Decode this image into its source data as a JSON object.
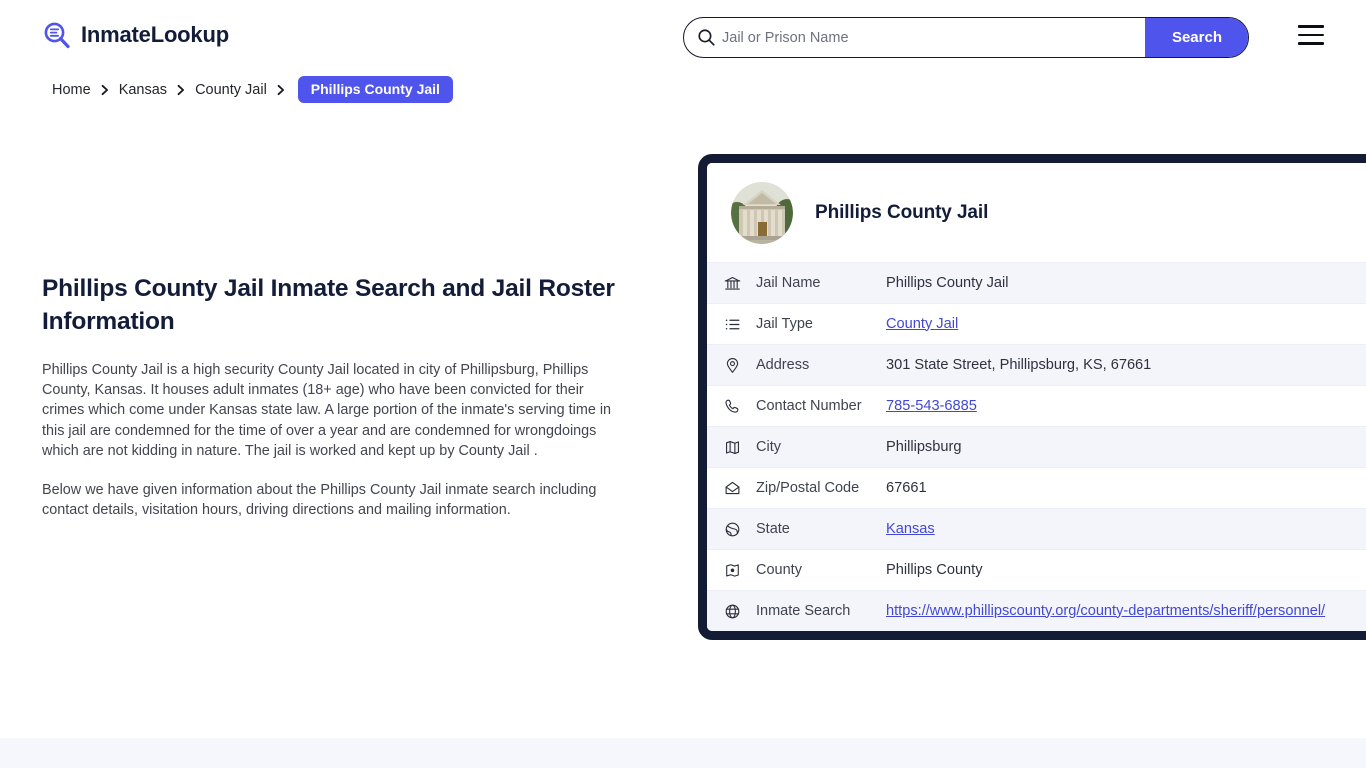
{
  "header": {
    "logo_text": "InmateLookup",
    "logo_icon": "magnifier-list-icon",
    "menu_icon": "hamburger-menu-icon",
    "search": {
      "icon": "search-icon",
      "placeholder": "Jail or Prison Name",
      "value": "",
      "button_label": "Search"
    }
  },
  "breadcrumb": {
    "items": [
      {
        "label": "Home",
        "current": false
      },
      {
        "label": "Kansas",
        "current": false
      },
      {
        "label": "County Jail",
        "current": false
      },
      {
        "label": "Phillips County Jail",
        "current": true
      }
    ],
    "separator": "❯"
  },
  "main": {
    "title": "Phillips County Jail Inmate Search and Jail Roster Information",
    "paragraphs": [
      "Phillips County Jail is a high security County Jail located in city of Phillipsburg, Phillips County, Kansas. It houses adult inmates (18+ age) who have been convicted for their crimes which come under Kansas state law. A large portion of the inmate's serving time in this jail are condemned for the time of over a year and are condemned for wrongdoings which are not kidding in nature. The jail is worked and kept up by County Jail .",
      "Below we have given information about the Phillips County Jail inmate search including contact details, visitation hours, driving directions and mailing information."
    ]
  },
  "card": {
    "avatar_icon": "courthouse-photo",
    "title": "Phillips County Jail",
    "rows": [
      {
        "icon": "bank-icon",
        "label": "Jail Name",
        "value": "Phillips County Jail",
        "is_link": false
      },
      {
        "icon": "list-icon",
        "label": "Jail Type",
        "value": "County Jail",
        "is_link": true
      },
      {
        "icon": "map-pin-icon",
        "label": "Address",
        "value": "301 State Street, Phillipsburg, KS, 67661",
        "is_link": false
      },
      {
        "icon": "phone-icon",
        "label": "Contact Number",
        "value": "785-543-6885",
        "is_link": true
      },
      {
        "icon": "map-icon",
        "label": "City",
        "value": "Phillipsburg",
        "is_link": false
      },
      {
        "icon": "envelope-icon",
        "label": "Zip/Postal Code",
        "value": "67661",
        "is_link": false
      },
      {
        "icon": "globe-tilt-icon",
        "label": "State",
        "value": "Kansas",
        "is_link": true
      },
      {
        "icon": "map-marker-icon",
        "label": "County",
        "value": "Phillips County",
        "is_link": false
      },
      {
        "icon": "globe-icon",
        "label": "Inmate Search",
        "value": "https://www.phillipscounty.org/county-departments/sheriff/personnel/",
        "is_link": true
      }
    ]
  },
  "colors": {
    "accent": "#4f55ec",
    "dark": "#131c38",
    "link": "#4248d4",
    "row_alt": "#f4f5fb",
    "footer_band": "#f6f6fd"
  }
}
